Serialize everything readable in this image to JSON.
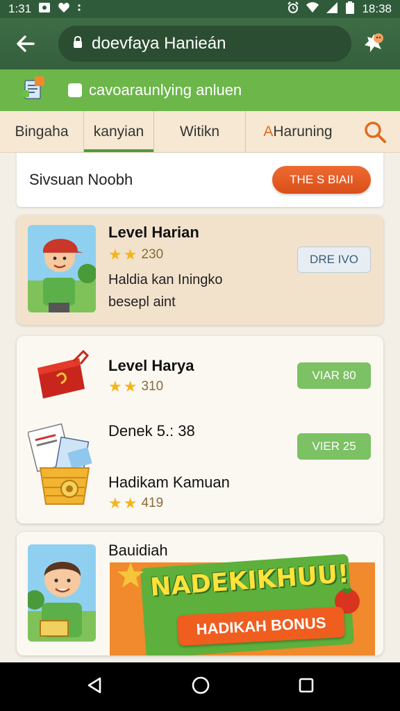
{
  "status": {
    "time_left": "1:31",
    "time_right": "18:38"
  },
  "appbar": {
    "url": "doevfaya Hanieán"
  },
  "subbar": {
    "text": "cavoaraunlying anluen"
  },
  "tabs": [
    {
      "label": "Bingaha"
    },
    {
      "label": "kanyian"
    },
    {
      "label": "Witikn"
    },
    {
      "label_accent": "A",
      "label_rest": "Haruning"
    }
  ],
  "panel": {
    "title": "Sivsuan Noobh",
    "button": "THE S BIAII"
  },
  "cards": [
    {
      "title": "Level Harian",
      "rating": "230",
      "desc_line1": "Haldia kan Iningko",
      "desc_line2": "besepl aint",
      "button": "DRE IVO"
    },
    {
      "title": "Level Harya",
      "rating": "310",
      "button": "VIAR 80"
    },
    {
      "title": "Denek 5.: 38",
      "button": "VIER 25"
    },
    {
      "title": "Hadikam Kamuan",
      "rating": "419"
    },
    {
      "title": "Bauidiah"
    }
  ],
  "banner": {
    "main": "NADEKIKHUU!",
    "sub": "HADIKAH BONUS"
  }
}
